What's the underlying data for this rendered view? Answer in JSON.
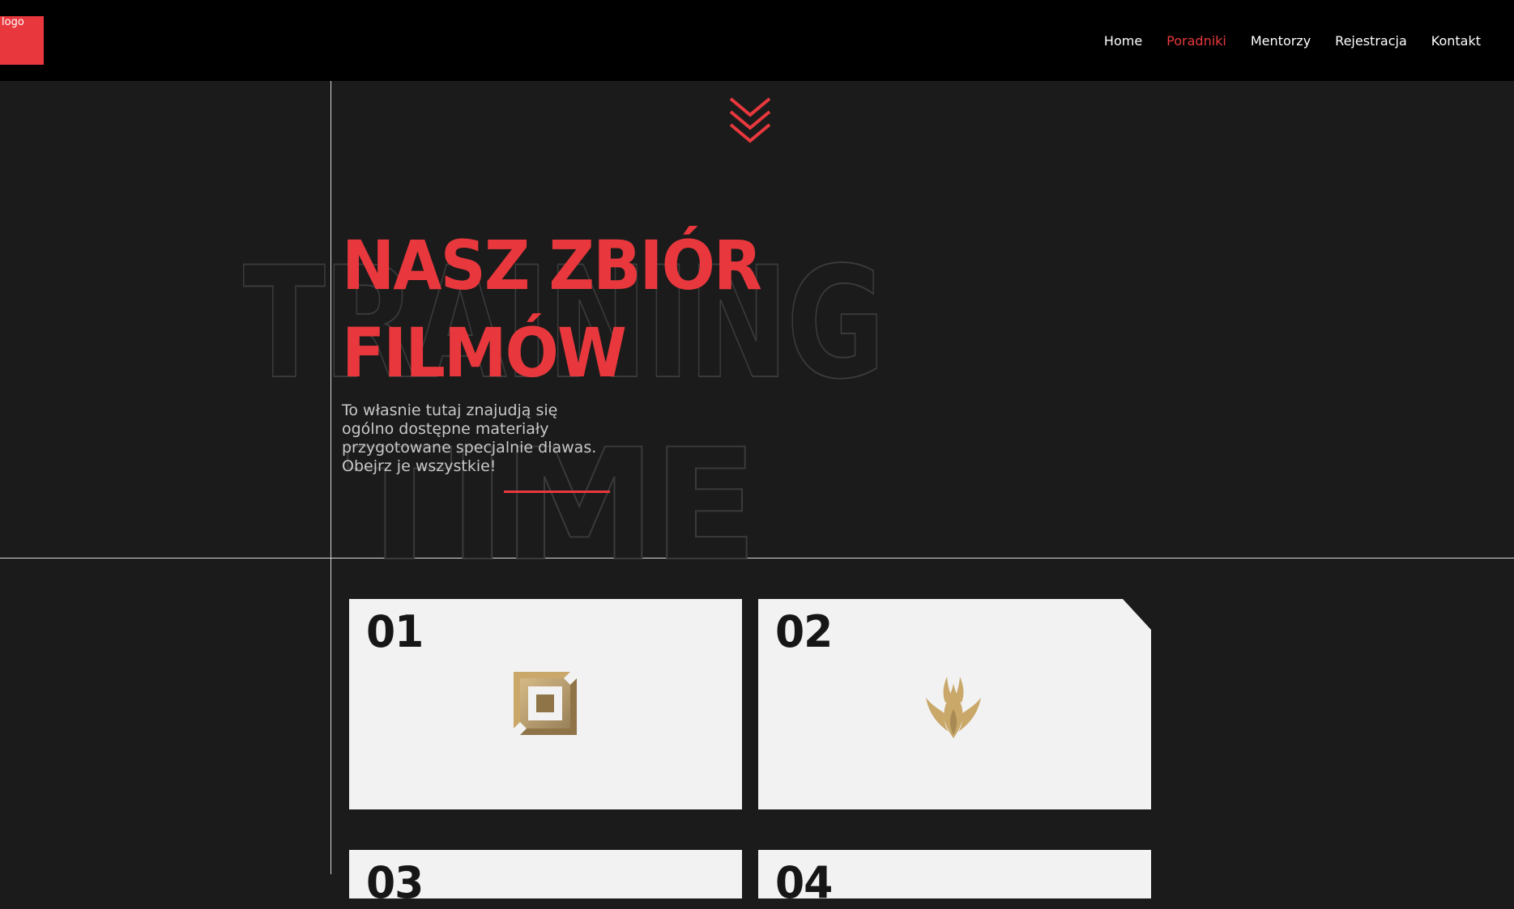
{
  "header": {
    "logo_alt": "logo",
    "nav": [
      {
        "label": "Home"
      },
      {
        "label": "Poradniki",
        "active": true
      },
      {
        "label": "Mentorzy"
      },
      {
        "label": "Rejestracja"
      },
      {
        "label": "Kontakt"
      }
    ]
  },
  "hero": {
    "bg_word_1": "TRAINING",
    "bg_word_2": "TIME",
    "title_line_1": "NASZ ZBIÓR",
    "title_line_2": "FILMÓW",
    "description": "To własnie tutaj znajudją się ogólno dostępne materiały przygotowane specjalnie dlawas. Obejrz je wszystkie!"
  },
  "cards": [
    {
      "number": "01",
      "icon": "valorant-rank-square-icon"
    },
    {
      "number": "02",
      "icon": "gold-flame-emblem-icon"
    },
    {
      "number": "03"
    },
    {
      "number": "04"
    }
  ],
  "colors": {
    "accent": "#e8383d",
    "header_bg": "#000000",
    "page_bg": "#1b1b1b",
    "card_bg": "#f2f2f2",
    "icon_gold": "#c9a86a"
  }
}
